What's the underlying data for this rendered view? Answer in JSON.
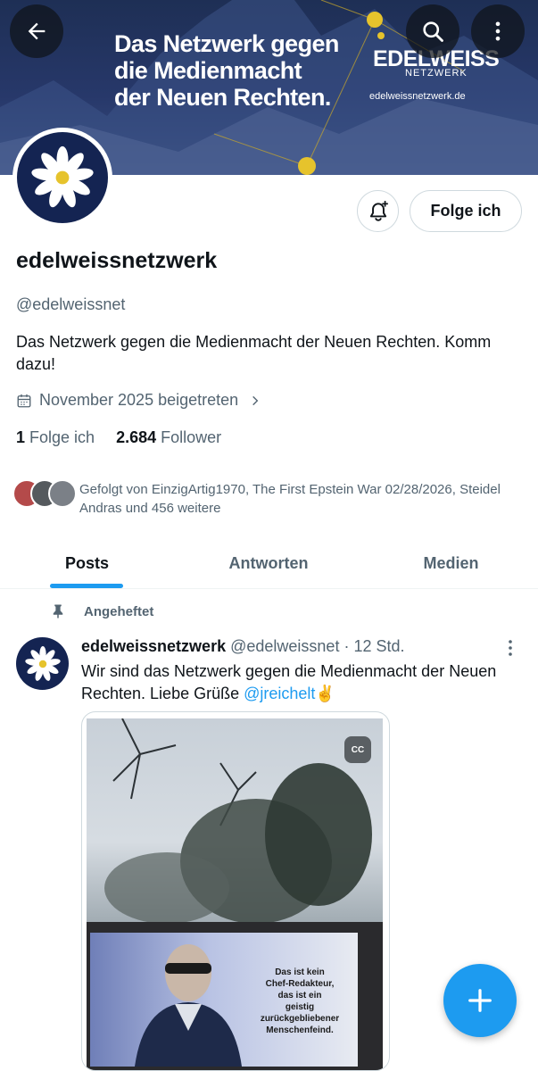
{
  "banner": {
    "headline": [
      "Das Netzwerk gegen",
      "die Medienmacht",
      "der Neuen Rechten."
    ],
    "logo_brand": "EDELWEISS",
    "logo_sub": "NETZWERK",
    "logo_url": "edelweissnetzwerk.de"
  },
  "top_actions": {
    "back_icon": "arrow-left-icon",
    "search_icon": "search-icon",
    "more_icon": "more-vertical-icon"
  },
  "profile": {
    "display_name": "edelweissnetzwerk",
    "handle": "@edelweissnet",
    "bio": "Das Netzwerk gegen die Medienmacht der Neuen Rechten. Komm dazu!",
    "joined": "November 2025 beigetreten",
    "following_count": "1",
    "following_label": "Folge ich",
    "followers_count": "2.684",
    "followers_label": "Follower",
    "followed_by": "Gefolgt von EinzigArtig1970, The First Epstein War 02/28/2026, Steidel Andras und 456 weitere",
    "follow_button_label": "Folge ich"
  },
  "tabs": [
    {
      "label": "Posts",
      "active": true
    },
    {
      "label": "Antworten",
      "active": false
    },
    {
      "label": "Medien",
      "active": false
    }
  ],
  "pinned_post": {
    "pinned_label": "Angeheftet",
    "author_name": "edelweissnetzwerk",
    "author_handle": "@edelweissnet",
    "separator": " · ",
    "time": "12 Std.",
    "text_before_mention": "Wir sind das Netzwerk gegen die Medienmacht der Neuen Rechten. Liebe Grüße ",
    "mention": "@jreichelt",
    "emoji": "✌",
    "media": {
      "cc_label": "CC",
      "billboard_lines": [
        "Das ist kein",
        "Chef-Redakteur,",
        "das ist ein",
        "geistig",
        "zurückgebliebener",
        "Menschenfeind."
      ]
    }
  },
  "colors": {
    "accent": "#1d9bf0",
    "text_primary": "#0f1419",
    "text_secondary": "#536471",
    "banner_bg": "#27386a",
    "avatar_bg": "#142452"
  }
}
